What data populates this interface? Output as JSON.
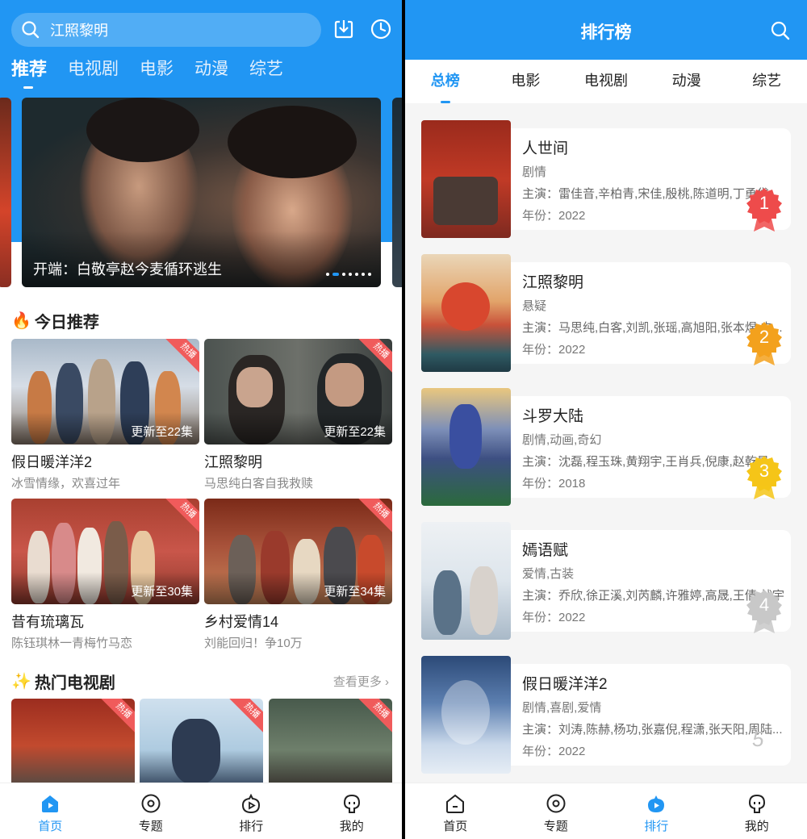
{
  "left": {
    "search": {
      "text": "江照黎明"
    },
    "tabs": [
      "推荐",
      "电视剧",
      "电影",
      "动漫",
      "综艺"
    ],
    "banner": {
      "caption": "开端：白敬亭赵今麦循环逃生"
    },
    "today": {
      "title": "今日推荐",
      "cards": [
        {
          "name": "假日暖洋洋2",
          "sub": "冰雪情缘，欢喜过年",
          "update": "更新至22集",
          "badge": "热播"
        },
        {
          "name": "江照黎明",
          "sub": "马思纯白客自我救赎",
          "update": "更新至22集",
          "badge": "热播"
        },
        {
          "name": "昔有琉璃瓦",
          "sub": "陈钰琪林一青梅竹马恋",
          "update": "更新至30集",
          "badge": "热播"
        },
        {
          "name": "乡村爱情14",
          "sub": "刘能回归！争10万",
          "update": "更新至34集",
          "badge": "热播"
        }
      ]
    },
    "hot": {
      "title": "热门电视剧",
      "more": "查看更多",
      "badges": [
        "热播",
        "热播",
        "热播"
      ]
    },
    "nav": [
      "首页",
      "专题",
      "排行",
      "我的"
    ]
  },
  "right": {
    "title": "排行榜",
    "tabs": [
      "总榜",
      "电影",
      "电视剧",
      "动漫",
      "综艺"
    ],
    "items": [
      {
        "rank": "1",
        "title": "人世间",
        "genre": "剧情",
        "cast": "主演：雷佳音,辛柏青,宋佳,殷桃,陈道明,丁勇岱...",
        "year": "年份：2022"
      },
      {
        "rank": "2",
        "title": "江照黎明",
        "genre": "悬疑",
        "cast": "主演：马思纯,白客,刘凯,张瑶,高旭阳,张本煜,史...",
        "year": "年份：2022"
      },
      {
        "rank": "3",
        "title": "斗罗大陆",
        "genre": "剧情,动画,奇幻",
        "cast": "主演：沈磊,程玉珠,黄翔宇,王肖兵,倪康,赵乾景...",
        "year": "年份：2018"
      },
      {
        "rank": "4",
        "title": "嫣语赋",
        "genre": "爱情,古装",
        "cast": "主演：乔欣,徐正溪,刘芮麟,许雅婷,高晟,王倩,战宇",
        "year": "年份：2022"
      },
      {
        "rank": "5",
        "title": "假日暖洋洋2",
        "genre": "剧情,喜剧,爱情",
        "cast": "主演：刘涛,陈赫,杨功,张嘉倪,程潇,张天阳,周陆...",
        "year": "年份：2022"
      }
    ],
    "nav": [
      "首页",
      "专题",
      "排行",
      "我的"
    ]
  },
  "colors": {
    "accent": "#2196f3",
    "badge": "#f05b5b",
    "gold": "#f5c518",
    "silver": "#c8c8c8",
    "bronze": "#f3a11d",
    "first": "#ee4b4b"
  }
}
